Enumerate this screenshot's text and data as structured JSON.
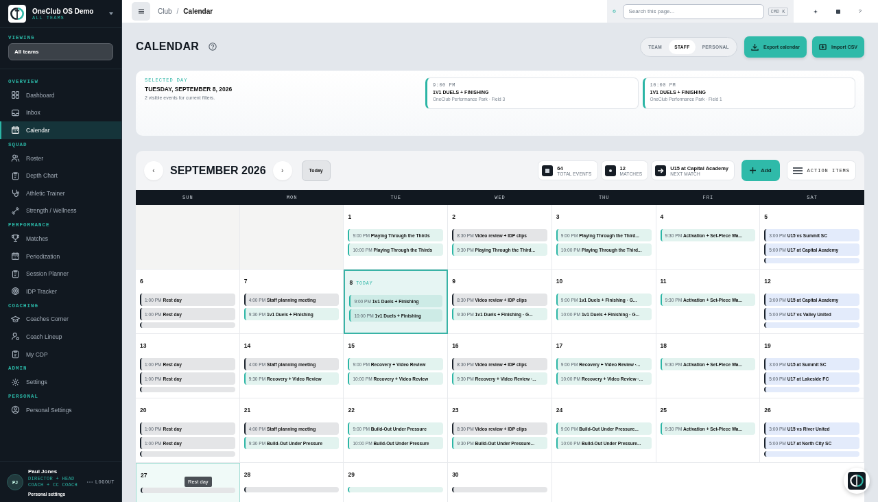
{
  "sidebar": {
    "brand": {
      "name": "OneClub OS Demo",
      "subtitle": "ALL TEAMS"
    },
    "viewing": {
      "label": "VIEWING",
      "value": "All teams"
    },
    "sections": [
      {
        "title": "OVERVIEW",
        "items": [
          {
            "label": "Dashboard",
            "selected": false
          },
          {
            "label": "Inbox",
            "selected": false
          },
          {
            "label": "Calendar",
            "selected": true
          }
        ]
      },
      {
        "title": "SQUAD",
        "items": [
          {
            "label": "Roster",
            "selected": false
          },
          {
            "label": "Depth Chart",
            "selected": false
          },
          {
            "label": "Athletic Trainer",
            "selected": false
          },
          {
            "label": "Strength / Wellness",
            "selected": false
          }
        ]
      },
      {
        "title": "PERFORMANCE",
        "items": [
          {
            "label": "Matches",
            "selected": false
          },
          {
            "label": "Periodization",
            "selected": false
          },
          {
            "label": "Session Planner",
            "selected": false
          },
          {
            "label": "IDP Tracker",
            "selected": false
          }
        ]
      },
      {
        "title": "COACHING",
        "items": [
          {
            "label": "Coaches Corner",
            "selected": false
          },
          {
            "label": "Coach Lineup",
            "selected": false
          },
          {
            "label": "My CDP",
            "selected": false
          }
        ]
      },
      {
        "title": "ADMIN",
        "items": [
          {
            "label": "Settings",
            "selected": false
          }
        ]
      },
      {
        "title": "PERSONAL",
        "items": [
          {
            "label": "Personal Settings",
            "selected": false
          }
        ]
      }
    ],
    "user": {
      "initials": "PJ",
      "name": "Paul Jones",
      "role": "DIRECTOR + HEAD COACH + CC COACH",
      "logout": "LOGOUT",
      "link": "Personal settings"
    }
  },
  "topbar": {
    "breadcrumb": [
      "Club",
      "Calendar"
    ],
    "separator": "/",
    "search": {
      "placeholder": "Search this page...",
      "shortcut": "CMD K"
    },
    "help": "?"
  },
  "header": {
    "title": "CALENDAR",
    "views": [
      {
        "label": "TEAM",
        "selected": false
      },
      {
        "label": "STAFF",
        "selected": true
      },
      {
        "label": "PERSONAL",
        "selected": false
      }
    ],
    "buttons": [
      "Export calendar",
      "Import CSV"
    ]
  },
  "selected_day": {
    "label": "SELECTED DAY",
    "date": "TUESDAY, SEPTEMBER 8, 2026",
    "summary": "2 visible events for current filters.",
    "events": [
      {
        "time": "9:00 PM",
        "title": "1V1 DUELS + FINISHING",
        "location": "OneClub Performance Park · Field 3"
      },
      {
        "time": "10:00 PM",
        "title": "1V1 DUELS + FINISHING",
        "location": "OneClub Performance Park · Field 1"
      }
    ]
  },
  "calendar": {
    "prev": "‹",
    "month": "SEPTEMBER 2026",
    "next": "›",
    "today": "Today",
    "stats": [
      {
        "value": "64",
        "label": "TOTAL EVENTS"
      },
      {
        "value": "12",
        "label": "MATCHES"
      },
      {
        "value": "U15 at Capital Academy",
        "label": "NEXT MATCH"
      }
    ],
    "add": "Add",
    "action_items": "ACTION ITEMS",
    "weekdays": [
      "SUN",
      "MON",
      "TUE",
      "WED",
      "THU",
      "FRI",
      "SAT"
    ],
    "days": [
      {
        "kind": "pad"
      },
      {
        "kind": "pad"
      },
      {
        "kind": "day",
        "day": "1",
        "today": false,
        "hovered": false,
        "events": [
          {
            "kind": "session",
            "time": "9:00 PM",
            "title": "Playing Through the Thirds"
          },
          {
            "kind": "session",
            "time": "10:00 PM",
            "title": "Playing Through the Thirds"
          }
        ]
      },
      {
        "kind": "day",
        "day": "2",
        "today": false,
        "hovered": false,
        "events": [
          {
            "kind": "neutral",
            "time": "8:30 PM",
            "title": "Video review + IDP clips"
          },
          {
            "kind": "session",
            "time": "9:30 PM",
            "title": "Playing Through the Third..."
          }
        ]
      },
      {
        "kind": "day",
        "day": "3",
        "today": false,
        "hovered": false,
        "events": [
          {
            "kind": "session",
            "time": "9:00 PM",
            "title": "Playing Through the Third..."
          },
          {
            "kind": "session",
            "time": "10:00 PM",
            "title": "Playing Through the Third..."
          }
        ]
      },
      {
        "kind": "day",
        "day": "4",
        "today": false,
        "hovered": false,
        "events": [
          {
            "kind": "session",
            "time": "9:30 PM",
            "title": "Activation + Set-Piece Wa..."
          }
        ]
      },
      {
        "kind": "day",
        "day": "5",
        "today": false,
        "hovered": false,
        "more": {
          "kind": "match"
        },
        "events": [
          {
            "kind": "match",
            "time": "3:00 PM",
            "title": "U15 vs Summit SC"
          },
          {
            "kind": "match",
            "time": "5:00 PM",
            "title": "U17 at Capital Academy"
          }
        ]
      },
      {
        "kind": "day",
        "day": "6",
        "today": false,
        "hovered": false,
        "more": {
          "kind": "neutral"
        },
        "events": [
          {
            "kind": "neutral",
            "time": "1:00 PM",
            "title": "Rest day"
          },
          {
            "kind": "neutral",
            "time": "1:00 PM",
            "title": "Rest day"
          }
        ]
      },
      {
        "kind": "day",
        "day": "7",
        "today": false,
        "hovered": false,
        "events": [
          {
            "kind": "neutral",
            "time": "4:00 PM",
            "title": "Staff planning meeting"
          },
          {
            "kind": "session",
            "time": "9:30 PM",
            "title": "1v1 Duels + Finishing"
          }
        ]
      },
      {
        "kind": "day",
        "day": "8",
        "today": true,
        "today_label": "TODAY",
        "hovered": false,
        "events": [
          {
            "kind": "session",
            "time": "9:00 PM",
            "title": "1v1 Duels + Finishing"
          },
          {
            "kind": "session",
            "time": "10:00 PM",
            "title": "1v1 Duels + Finishing"
          }
        ]
      },
      {
        "kind": "day",
        "day": "9",
        "today": false,
        "hovered": false,
        "events": [
          {
            "kind": "neutral",
            "time": "8:30 PM",
            "title": "Video review + IDP clips"
          },
          {
            "kind": "session",
            "time": "9:30 PM",
            "title": "1v1 Duels + Finishing · G..."
          }
        ]
      },
      {
        "kind": "day",
        "day": "10",
        "today": false,
        "hovered": false,
        "events": [
          {
            "kind": "session",
            "time": "9:00 PM",
            "title": "1v1 Duels + Finishing · G..."
          },
          {
            "kind": "session",
            "time": "10:00 PM",
            "title": "1v1 Duels + Finishing · G..."
          }
        ]
      },
      {
        "kind": "day",
        "day": "11",
        "today": false,
        "hovered": false,
        "events": [
          {
            "kind": "session",
            "time": "9:30 PM",
            "title": "Activation + Set-Piece Wa..."
          }
        ]
      },
      {
        "kind": "day",
        "day": "12",
        "today": false,
        "hovered": false,
        "more": {
          "kind": "match"
        },
        "events": [
          {
            "kind": "match",
            "time": "3:00 PM",
            "title": "U15 at Capital Academy"
          },
          {
            "kind": "match",
            "time": "5:00 PM",
            "title": "U17 vs Valley United"
          }
        ]
      },
      {
        "kind": "day",
        "day": "13",
        "today": false,
        "hovered": false,
        "more": {
          "kind": "neutral"
        },
        "events": [
          {
            "kind": "neutral",
            "time": "1:00 PM",
            "title": "Rest day"
          },
          {
            "kind": "neutral",
            "time": "1:00 PM",
            "title": "Rest day"
          }
        ]
      },
      {
        "kind": "day",
        "day": "14",
        "today": false,
        "hovered": false,
        "events": [
          {
            "kind": "neutral",
            "time": "4:00 PM",
            "title": "Staff planning meeting"
          },
          {
            "kind": "session",
            "time": "9:30 PM",
            "title": "Recovery + Video Review"
          }
        ]
      },
      {
        "kind": "day",
        "day": "15",
        "today": false,
        "hovered": false,
        "events": [
          {
            "kind": "session",
            "time": "9:00 PM",
            "title": "Recovery + Video Review"
          },
          {
            "kind": "session",
            "time": "10:00 PM",
            "title": "Recovery + Video Review"
          }
        ]
      },
      {
        "kind": "day",
        "day": "16",
        "today": false,
        "hovered": false,
        "events": [
          {
            "kind": "neutral",
            "time": "8:30 PM",
            "title": "Video review + IDP clips"
          },
          {
            "kind": "session",
            "time": "9:30 PM",
            "title": "Recovery + Video Review ·..."
          }
        ]
      },
      {
        "kind": "day",
        "day": "17",
        "today": false,
        "hovered": false,
        "events": [
          {
            "kind": "session",
            "time": "9:00 PM",
            "title": "Recovery + Video Review ·..."
          },
          {
            "kind": "session",
            "time": "10:00 PM",
            "title": "Recovery + Video Review ·..."
          }
        ]
      },
      {
        "kind": "day",
        "day": "18",
        "today": false,
        "hovered": false,
        "events": [
          {
            "kind": "session",
            "time": "9:30 PM",
            "title": "Activation + Set-Piece Wa..."
          }
        ]
      },
      {
        "kind": "day",
        "day": "19",
        "today": false,
        "hovered": false,
        "more": {
          "kind": "match"
        },
        "events": [
          {
            "kind": "match",
            "time": "3:00 PM",
            "title": "U15 at Summit SC"
          },
          {
            "kind": "match",
            "time": "5:00 PM",
            "title": "U17 at Lakeside FC"
          }
        ]
      },
      {
        "kind": "day",
        "day": "20",
        "today": false,
        "hovered": false,
        "more": {
          "kind": "neutral"
        },
        "events": [
          {
            "kind": "neutral",
            "time": "1:00 PM",
            "title": "Rest day"
          },
          {
            "kind": "neutral",
            "time": "1:00 PM",
            "title": "Rest day"
          }
        ]
      },
      {
        "kind": "day",
        "day": "21",
        "today": false,
        "hovered": false,
        "events": [
          {
            "kind": "neutral",
            "time": "4:00 PM",
            "title": "Staff planning meeting"
          },
          {
            "kind": "session",
            "time": "9:30 PM",
            "title": "Build-Out Under Pressure"
          }
        ]
      },
      {
        "kind": "day",
        "day": "22",
        "today": false,
        "hovered": false,
        "events": [
          {
            "kind": "session",
            "time": "9:00 PM",
            "title": "Build-Out Under Pressure"
          },
          {
            "kind": "session",
            "time": "10:00 PM",
            "title": "Build-Out Under Pressure"
          }
        ]
      },
      {
        "kind": "day",
        "day": "23",
        "today": false,
        "hovered": false,
        "events": [
          {
            "kind": "neutral",
            "time": "8:30 PM",
            "title": "Video review + IDP clips"
          },
          {
            "kind": "session",
            "time": "9:30 PM",
            "title": "Build-Out Under Pressure..."
          }
        ]
      },
      {
        "kind": "day",
        "day": "24",
        "today": false,
        "hovered": false,
        "events": [
          {
            "kind": "session",
            "time": "9:00 PM",
            "title": "Build-Out Under Pressure..."
          },
          {
            "kind": "session",
            "time": "10:00 PM",
            "title": "Build-Out Under Pressure..."
          }
        ]
      },
      {
        "kind": "day",
        "day": "25",
        "today": false,
        "hovered": false,
        "events": [
          {
            "kind": "session",
            "time": "9:30 PM",
            "title": "Activation + Set-Piece Wa..."
          }
        ]
      },
      {
        "kind": "day",
        "day": "26",
        "today": false,
        "hovered": false,
        "more": {
          "kind": "match"
        },
        "events": [
          {
            "kind": "match",
            "time": "3:00 PM",
            "title": "U15 vs River United"
          },
          {
            "kind": "match",
            "time": "5:00 PM",
            "title": "U17 at North City SC"
          }
        ]
      },
      {
        "kind": "day",
        "day": "27",
        "today": false,
        "hovered": true,
        "tooltip": "Rest day",
        "more": {
          "kind": "neutral"
        }
      },
      {
        "kind": "day",
        "day": "28",
        "today": false,
        "hovered": false,
        "more": {
          "kind": "neutral"
        }
      },
      {
        "kind": "day",
        "day": "29",
        "today": false,
        "hovered": false,
        "more": {
          "kind": "session"
        }
      },
      {
        "kind": "day",
        "day": "30",
        "today": false,
        "hovered": false,
        "more": {
          "kind": "neutral"
        }
      },
      {
        "kind": "blank"
      },
      {
        "kind": "blank"
      },
      {
        "kind": "blank"
      }
    ]
  }
}
